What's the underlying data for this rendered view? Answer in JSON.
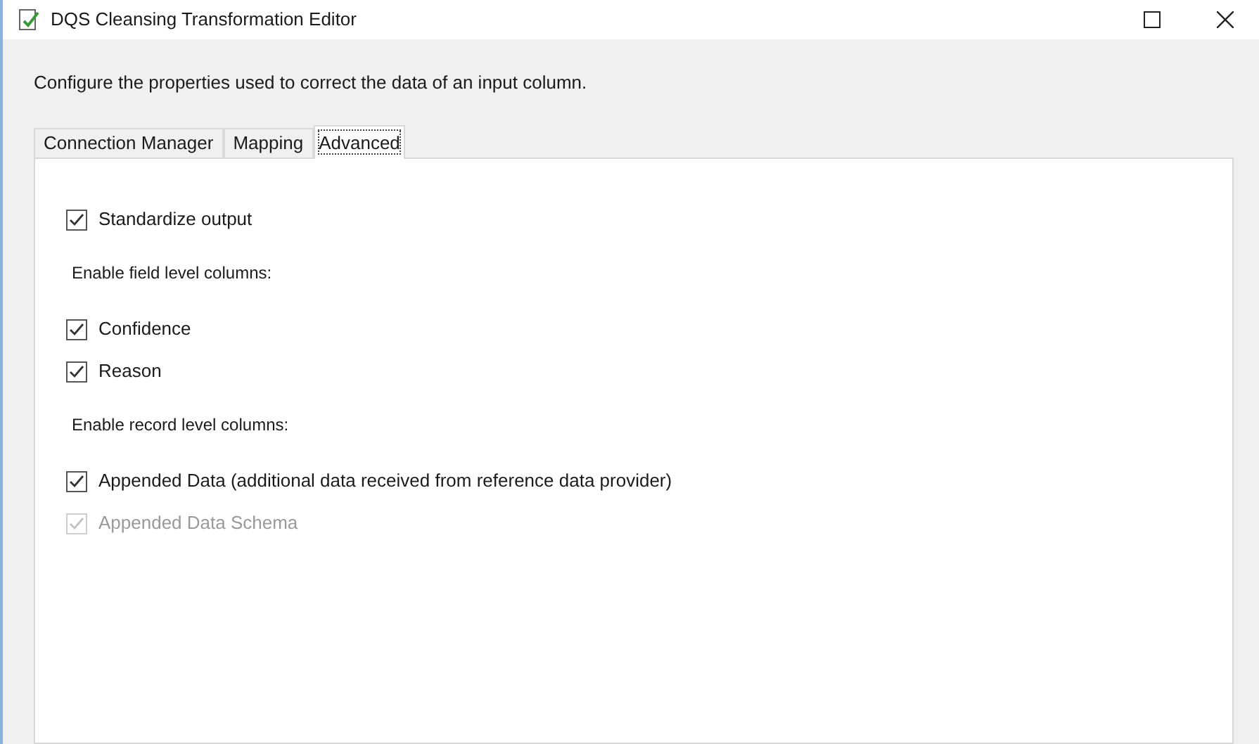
{
  "window": {
    "title": "DQS Cleansing Transformation Editor"
  },
  "description": "Configure the properties used to correct the data of an input column.",
  "tabs": [
    {
      "label": "Connection Manager",
      "selected": false
    },
    {
      "label": "Mapping",
      "selected": false
    },
    {
      "label": "Advanced",
      "selected": true
    }
  ],
  "options": [
    {
      "kind": "checkbox",
      "label": "Standardize output",
      "checked": true,
      "disabled": false
    },
    {
      "kind": "heading",
      "label": "Enable field level columns:"
    },
    {
      "kind": "checkbox",
      "label": "Confidence",
      "checked": true,
      "disabled": false
    },
    {
      "kind": "checkbox",
      "label": "Reason",
      "checked": true,
      "disabled": false
    },
    {
      "kind": "heading",
      "label": "Enable record level columns:"
    },
    {
      "kind": "checkbox",
      "label": "Appended Data (additional data received from reference data provider)",
      "checked": true,
      "disabled": false
    },
    {
      "kind": "checkbox",
      "label": "Appended Data Schema",
      "checked": true,
      "disabled": true
    }
  ]
}
